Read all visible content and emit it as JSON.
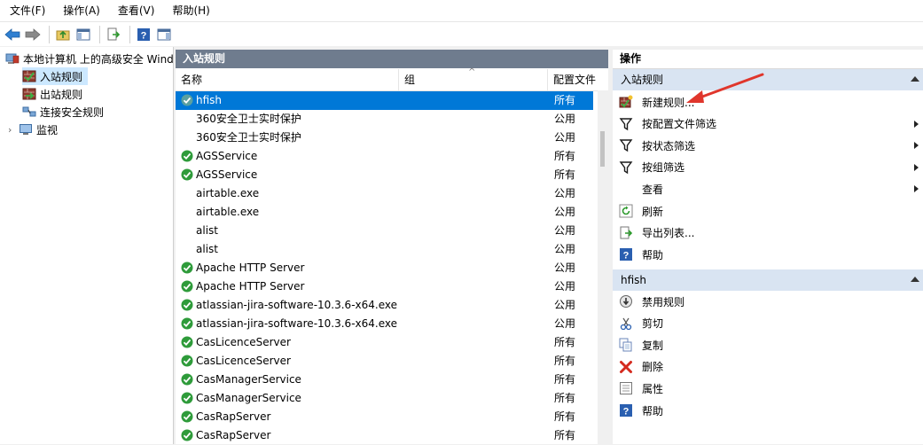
{
  "menu": [
    "文件(F)",
    "操作(A)",
    "查看(V)",
    "帮助(H)"
  ],
  "toolbar": [
    "back-arrow-icon",
    "forward-arrow-icon",
    "up-folder-icon",
    "show-hide-tree-icon",
    "export-list-icon",
    "help-icon",
    "show-hide-action-pane-icon"
  ],
  "tree": {
    "root": "本地计算机 上的高级安全 Windows Defender 防火墙",
    "items": [
      {
        "label": "入站规则",
        "selected": true
      },
      {
        "label": "出站规则",
        "selected": false
      },
      {
        "label": "连接安全规则",
        "selected": false
      },
      {
        "label": "监视",
        "selected": false
      }
    ]
  },
  "center": {
    "title": "入站规则",
    "columns": {
      "name": "名称",
      "group": "组",
      "profile": "配置文件"
    },
    "rows": [
      {
        "name": "hfish",
        "profile": "所有",
        "enabled": true,
        "selected": true
      },
      {
        "name": "360安全卫士实时保护",
        "profile": "公用",
        "enabled": false
      },
      {
        "name": "360安全卫士实时保护",
        "profile": "公用",
        "enabled": false
      },
      {
        "name": "AGSService",
        "profile": "所有",
        "enabled": true
      },
      {
        "name": "AGSService",
        "profile": "所有",
        "enabled": true
      },
      {
        "name": "airtable.exe",
        "profile": "公用",
        "enabled": false
      },
      {
        "name": "airtable.exe",
        "profile": "公用",
        "enabled": false
      },
      {
        "name": "alist",
        "profile": "公用",
        "enabled": false
      },
      {
        "name": "alist",
        "profile": "公用",
        "enabled": false
      },
      {
        "name": "Apache HTTP Server",
        "profile": "公用",
        "enabled": true
      },
      {
        "name": "Apache HTTP Server",
        "profile": "公用",
        "enabled": true
      },
      {
        "name": "atlassian-jira-software-10.3.6-x64.exe",
        "profile": "公用",
        "enabled": true
      },
      {
        "name": "atlassian-jira-software-10.3.6-x64.exe",
        "profile": "公用",
        "enabled": true
      },
      {
        "name": "CasLicenceServer",
        "profile": "所有",
        "enabled": true
      },
      {
        "name": "CasLicenceServer",
        "profile": "所有",
        "enabled": true
      },
      {
        "name": "CasManagerService",
        "profile": "所有",
        "enabled": true
      },
      {
        "name": "CasManagerService",
        "profile": "所有",
        "enabled": true
      },
      {
        "name": "CasRapServer",
        "profile": "所有",
        "enabled": true
      },
      {
        "name": "CasRapServer",
        "profile": "所有",
        "enabled": true
      }
    ]
  },
  "actions": {
    "title": "操作",
    "section1": {
      "title": "入站规则",
      "items": [
        {
          "label": "新建规则...",
          "icon": "new-rule-icon",
          "submenu": false
        },
        {
          "label": "按配置文件筛选",
          "icon": "filter-icon",
          "submenu": true
        },
        {
          "label": "按状态筛选",
          "icon": "filter-icon",
          "submenu": true
        },
        {
          "label": "按组筛选",
          "icon": "filter-icon",
          "submenu": true
        },
        {
          "label": "查看",
          "icon": "",
          "submenu": true
        },
        {
          "label": "刷新",
          "icon": "refresh-icon",
          "submenu": false
        },
        {
          "label": "导出列表...",
          "icon": "export-list-icon",
          "submenu": false
        },
        {
          "label": "帮助",
          "icon": "help-icon",
          "submenu": false
        }
      ]
    },
    "section2": {
      "title": "hfish",
      "items": [
        {
          "label": "禁用规则",
          "icon": "disable-rule-icon"
        },
        {
          "label": "剪切",
          "icon": "cut-icon"
        },
        {
          "label": "复制",
          "icon": "copy-icon"
        },
        {
          "label": "删除",
          "icon": "delete-icon"
        },
        {
          "label": "属性",
          "icon": "properties-icon"
        },
        {
          "label": "帮助",
          "icon": "help-icon"
        }
      ]
    }
  },
  "colors": {
    "selected": "#0078d7",
    "paneTitle": "#6f7c8e",
    "sectionHead": "#d9e4f2",
    "enabledGreen": "#2e9b3a",
    "annotationArrow": "#e0362c"
  }
}
